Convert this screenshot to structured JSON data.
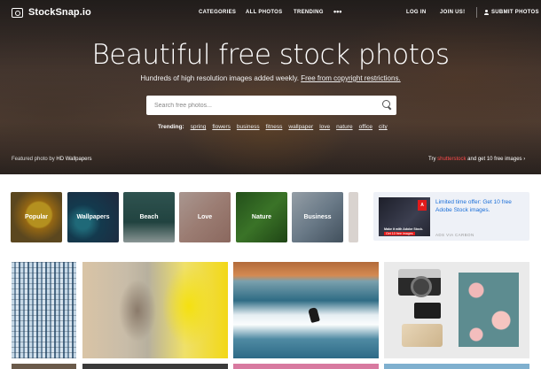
{
  "header": {
    "logo": "StockSnap.io",
    "nav": {
      "categories": "CATEGORIES",
      "all_photos": "ALL PHOTOS",
      "trending": "TRENDING",
      "more": "•••",
      "login": "LOG IN",
      "join": "JOIN US!",
      "submit": "SUBMIT PHOTOS"
    }
  },
  "hero": {
    "title": "Beautiful free stock photos",
    "subtitle_text": "Hundreds of high resolution images added weekly.",
    "subtitle_link": "Free from copyright restrictions.",
    "search_placeholder": "Search free photos...",
    "trending_label": "Trending:",
    "trending_tags": [
      "spring",
      "flowers",
      "business",
      "fitness",
      "wallpaper",
      "love",
      "nature",
      "office",
      "city"
    ],
    "featured_prefix": "Featured photo by",
    "featured_author": "HD Wallpapers",
    "promo_prefix": "Try",
    "promo_brand": "shutterstock",
    "promo_suffix": "and get 10 free images",
    "promo_arrow": "›"
  },
  "categories": [
    "Popular",
    "Wallpapers",
    "Beach",
    "Love",
    "Nature",
    "Business"
  ],
  "ad": {
    "text": "Limited time offer: Get 10 free Adobe Stock images.",
    "via": "ADS VIA CARBON",
    "logo_letter": "A",
    "img_title": "Make it with Adobe Stock.",
    "img_cta": "Get 10 free images"
  }
}
